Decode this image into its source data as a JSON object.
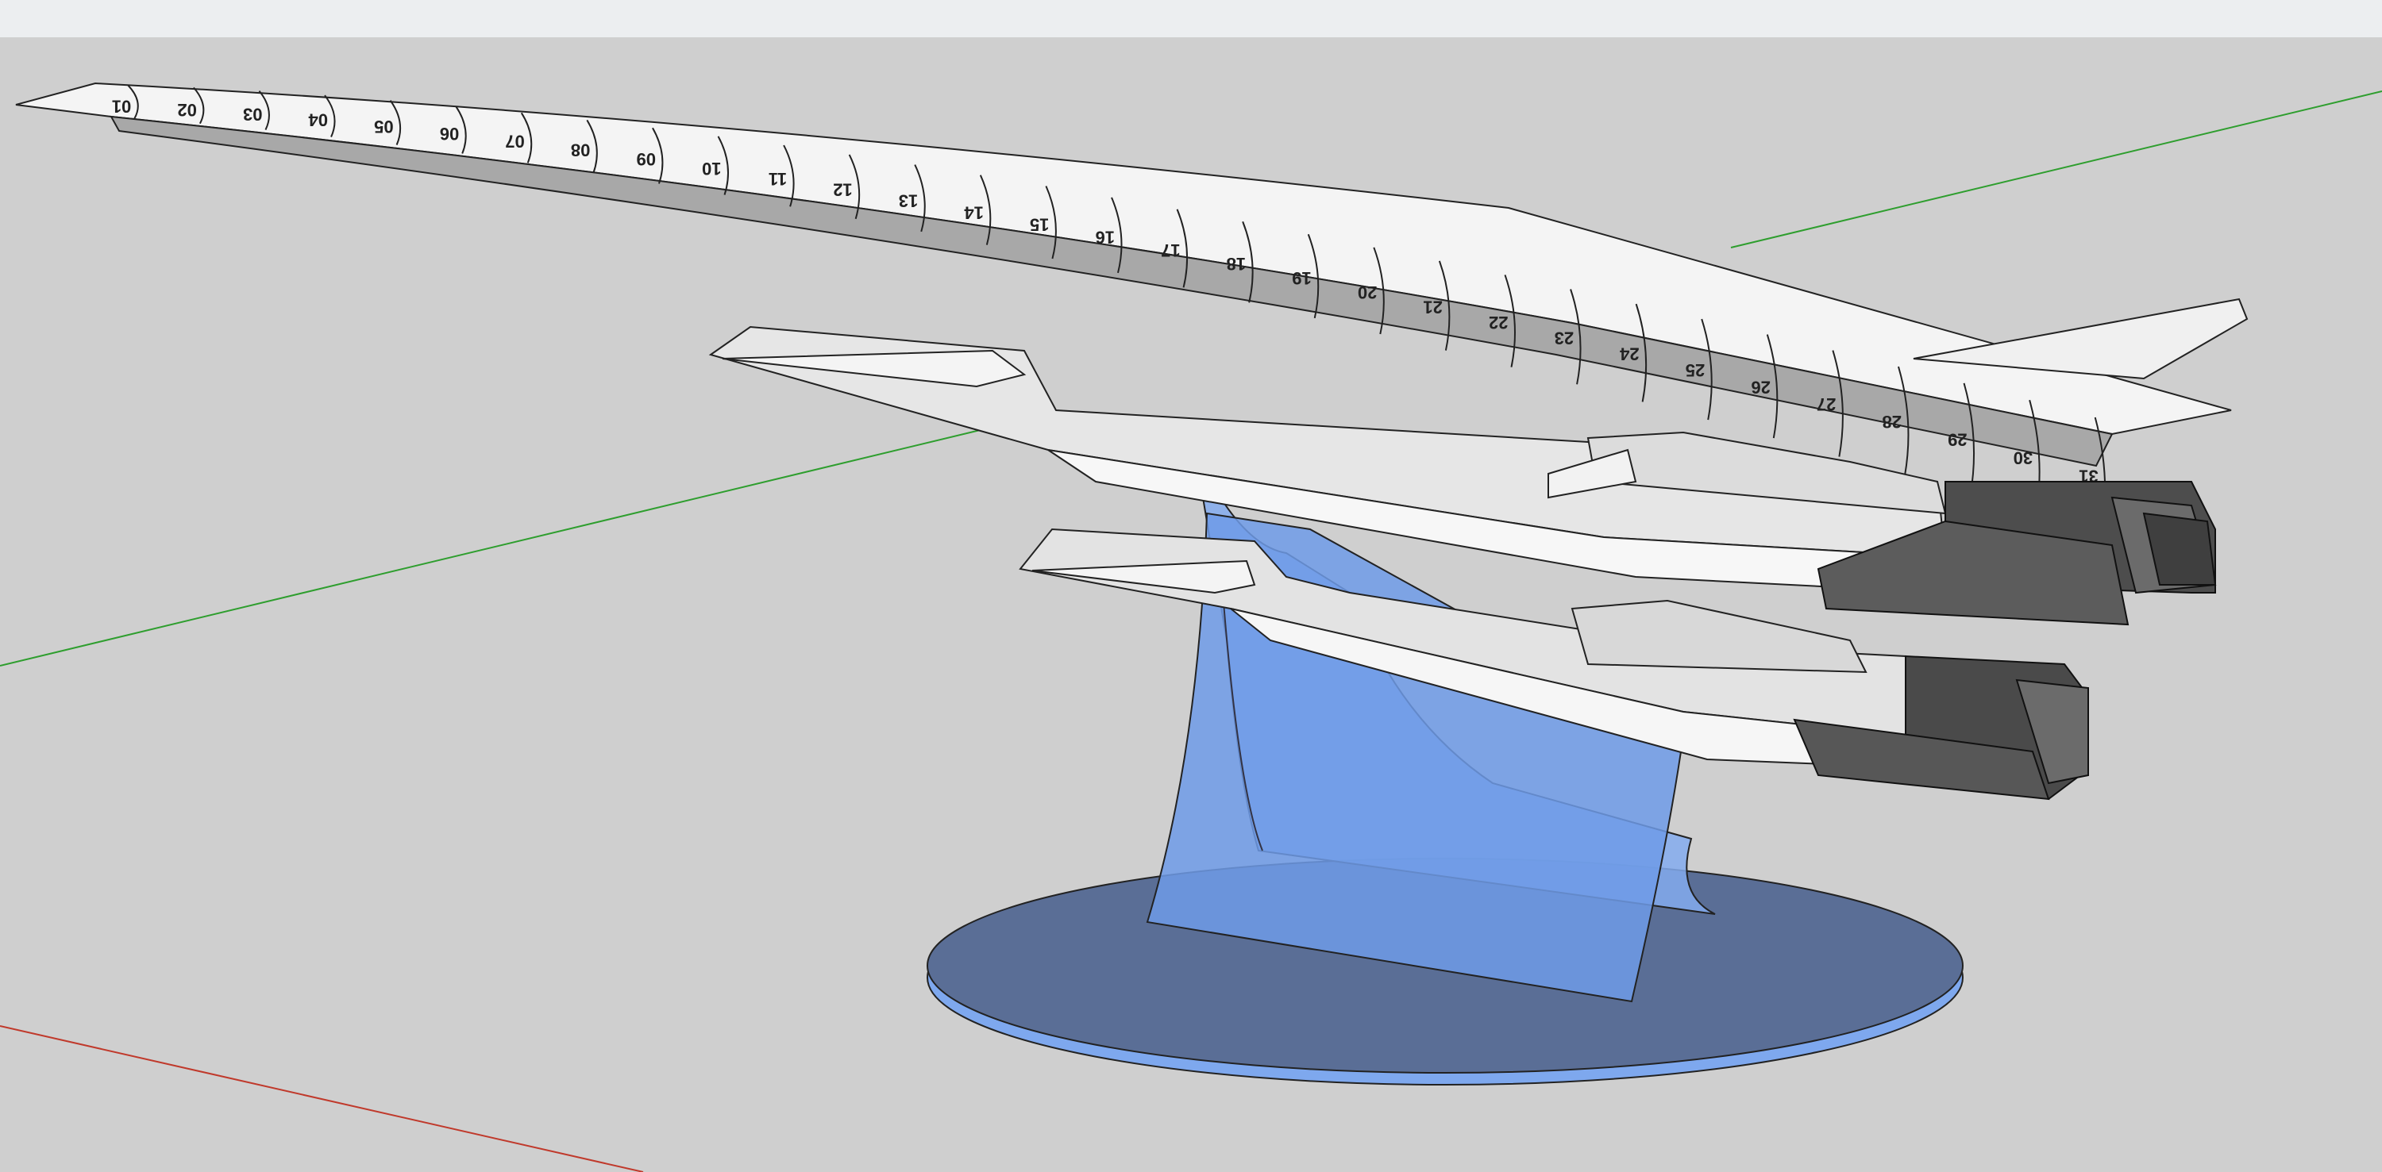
{
  "scene": {
    "background": "#cfcfcf",
    "axis_colors": {
      "x_red": "#c0392b",
      "y_green": "#2e9e2e"
    },
    "stand_color": "#6f9be8",
    "base_color": "#5a6e96",
    "section_numbers": [
      "01",
      "02",
      "03",
      "04",
      "05",
      "06",
      "07",
      "08",
      "09",
      "10",
      "11",
      "12",
      "13",
      "14",
      "15",
      "16",
      "17",
      "18",
      "19",
      "20",
      "21",
      "22",
      "23",
      "24",
      "25",
      "26",
      "27",
      "28",
      "29",
      "30",
      "31"
    ]
  }
}
